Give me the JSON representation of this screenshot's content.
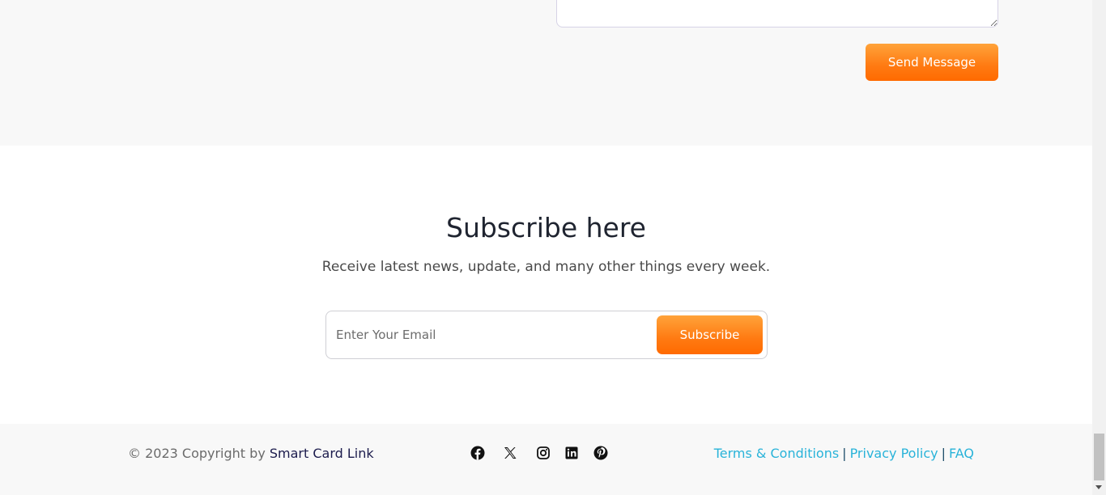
{
  "contact": {
    "send_label": "Send Message"
  },
  "subscribe": {
    "title": "Subscribe here",
    "subtitle": "Receive latest news, update, and many other things every week.",
    "email_placeholder": "Enter Your Email",
    "email_value": "",
    "button_label": "Subscribe"
  },
  "footer": {
    "copyright_prefix": "© 2023 Copyright by",
    "brand": "Smart Card Link",
    "social": [
      "facebook-icon",
      "x-icon",
      "instagram-icon",
      "linkedin-icon",
      "pinterest-icon"
    ],
    "links": {
      "terms": "Terms & Conditions",
      "privacy": "Privacy Policy",
      "faq": "FAQ",
      "separator": "|"
    }
  },
  "colors": {
    "accent_orange": "#ff7a12",
    "link_blue": "#29b3d9",
    "brand_navy": "#1c1c4d",
    "section_gray": "#f8f8f8"
  }
}
